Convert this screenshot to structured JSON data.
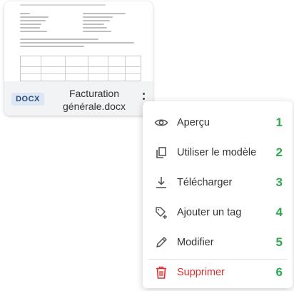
{
  "file_card": {
    "type_badge": "DOCX",
    "file_name_line1": "Facturation",
    "file_name_line2": "générale.docx"
  },
  "context_menu": {
    "items": [
      {
        "label": "Aperçu",
        "number": "1",
        "icon": "eye-icon"
      },
      {
        "label": "Utiliser le modèle",
        "number": "2",
        "icon": "copy-template-icon"
      },
      {
        "label": "Télécharger",
        "number": "3",
        "icon": "download-icon"
      },
      {
        "label": "Ajouter un tag",
        "number": "4",
        "icon": "tag-add-icon"
      },
      {
        "label": "Modifier",
        "number": "5",
        "icon": "pencil-icon"
      },
      {
        "label": "Supprimer",
        "number": "6",
        "icon": "trash-icon"
      }
    ]
  },
  "colors": {
    "annotation_number": "#2fa84f",
    "danger": "#d9302e",
    "badge_bg": "#dce6f5",
    "badge_text": "#2a4a7a"
  }
}
